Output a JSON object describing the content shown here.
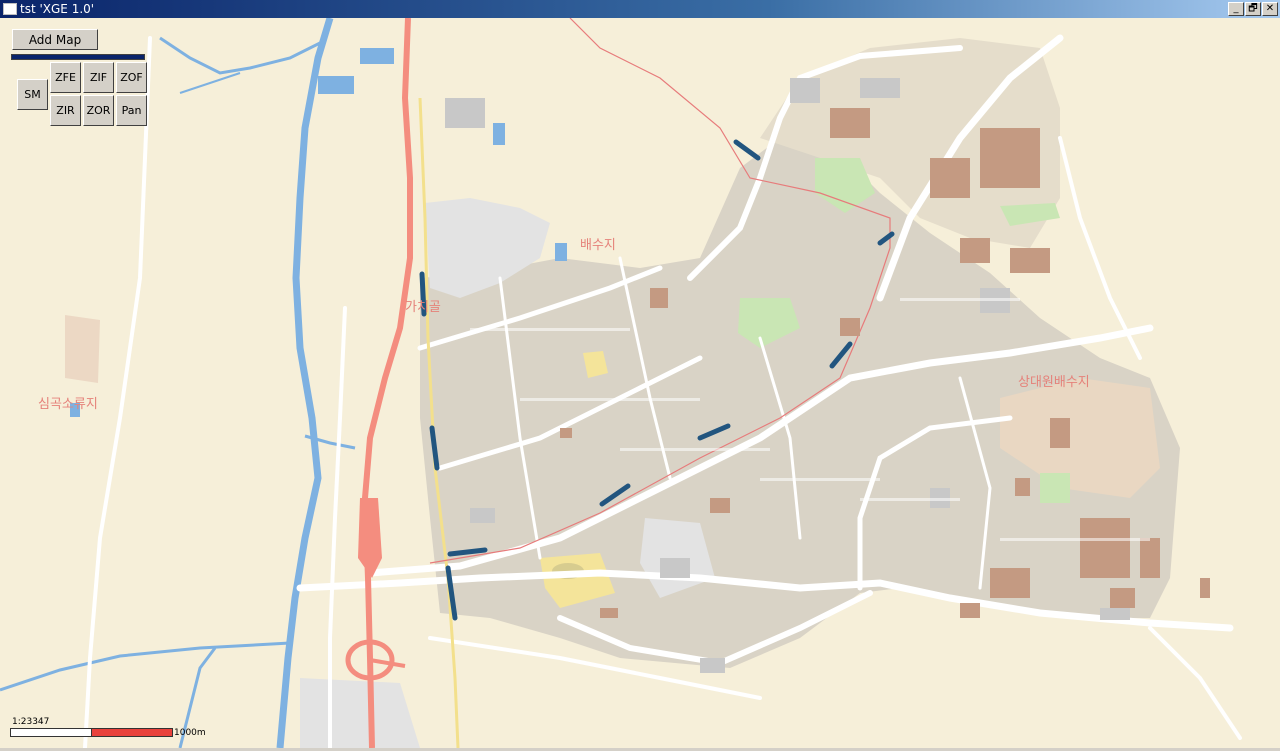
{
  "window": {
    "title": "tst 'XGE 1.0'",
    "controls": {
      "minimize": "_",
      "restore": "🗗",
      "close": "✕"
    }
  },
  "toolbar": {
    "add_map_label": "Add Map",
    "progress": 1.0,
    "buttons": {
      "sm": "SM",
      "zfe": "ZFE",
      "zif": "ZIF",
      "zof": "ZOF",
      "zir": "ZIR",
      "zor": "ZOR",
      "pan": "Pan"
    }
  },
  "map": {
    "labels": {
      "baesuji": "배수지",
      "gachigol": "가치골",
      "simgok": "심곡소류지",
      "sangdaewon": "상대원배수지"
    },
    "colors": {
      "land": "#f6efd9",
      "water": "#7eb1e1",
      "motorway": "#f48d7f",
      "road": "#ffffff",
      "urban": "#d8d3c7",
      "building": "#c49a82",
      "park": "#c9e6b4",
      "stadium": "#f4e49a",
      "railway": "#22557f"
    }
  },
  "scale": {
    "ratio": "1:23347",
    "distance": "1000m"
  }
}
